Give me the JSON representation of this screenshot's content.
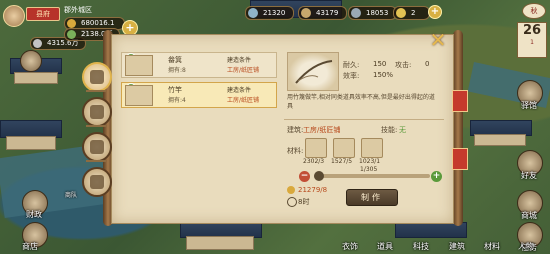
{
  "hud": {
    "badge": "县府",
    "area_label": "郡外城区",
    "copper": "680016.1万",
    "population": "4315.6万",
    "food": "2138.0万",
    "top_resources": [
      "21320",
      "43179",
      "18053",
      "2"
    ]
  },
  "calendar": {
    "season": "秋",
    "day": "26",
    "year": "1"
  },
  "right_buttons": [
    "驿馆",
    "好友",
    "商城",
    "任务"
  ],
  "left_status": [
    "商队",
    "财政"
  ],
  "bottom_bar": [
    "商店",
    "衣饰",
    "道具",
    "科技",
    "建筑",
    "材料",
    "人物"
  ],
  "panel": {
    "list": [
      {
        "name": "畚箕",
        "owned": "拥有:8",
        "cond_label": "建造条件",
        "cond_value": "工房/纸匠铺",
        "selected": false
      },
      {
        "name": "竹竿",
        "owned": "拥有:4",
        "cond_label": "建造条件",
        "cond_value": "工房/纸匠铺",
        "selected": true
      }
    ],
    "detail": {
      "stats": [
        {
          "label": "耐久:",
          "value": "150"
        },
        {
          "label": "攻击:",
          "value": "0"
        },
        {
          "label": "效率:",
          "value": "150%"
        }
      ],
      "description": "用竹篾做竿,相对同类道具效率不高,但是最好出得起的道具",
      "build_label": "建筑:",
      "build_value": "工房/纸匠铺",
      "skill_label": "技能:",
      "skill_value": "无",
      "material_label": "材料:",
      "materials": [
        "2302/3",
        "1527/5",
        "1023/1"
      ],
      "quantity": "1/305",
      "cost": "21279/8",
      "time": "8时",
      "craft_label": "制作"
    }
  },
  "colors": {
    "accent": "#e0b44d",
    "panel_bg": "#e9dcbd",
    "warn": "#b84a1d",
    "good": "#5a9a3b"
  }
}
